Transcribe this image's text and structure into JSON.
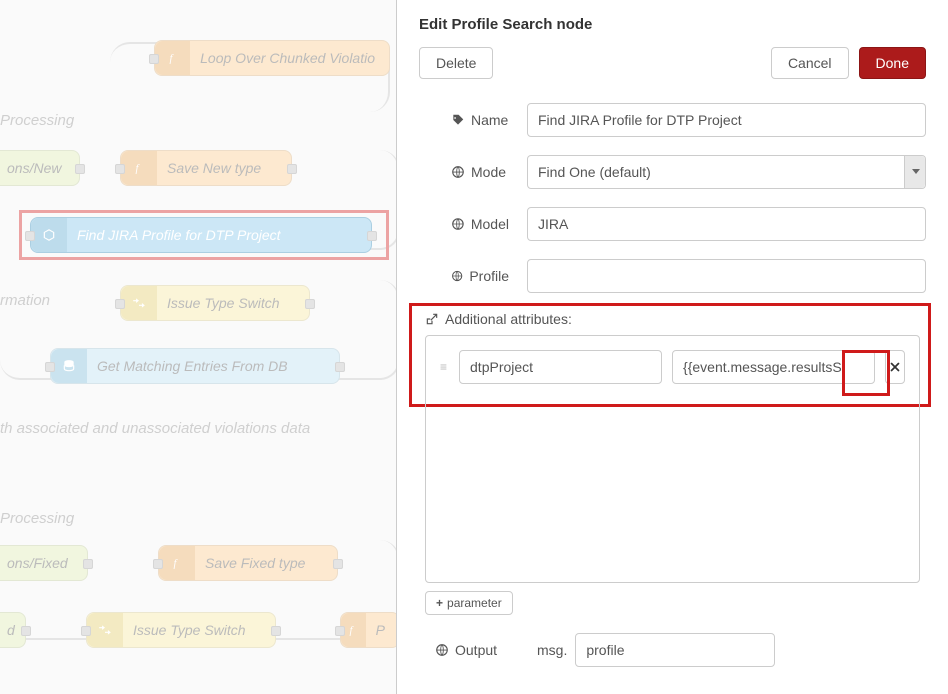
{
  "panel": {
    "title": "Edit Profile Search node",
    "delete": "Delete",
    "cancel": "Cancel",
    "done": "Done",
    "labels": {
      "name": "Name",
      "mode": "Mode",
      "model": "Model",
      "profile": "Profile",
      "additional": "Additional attributes:",
      "output": "Output"
    },
    "fields": {
      "name": "Find JIRA Profile for DTP Project",
      "mode": "Find One (default)",
      "model": "JIRA",
      "profile": "",
      "attr_key": "dtpProject",
      "attr_value": "{{event.message.resultsS",
      "output_prefix": "msg.",
      "output_value": "profile",
      "add_param": "parameter"
    }
  },
  "workspace": {
    "comments": {
      "processing1": "Processing",
      "rmation": "rmation",
      "withAssoc": "th associated and unassociated violations data",
      "processing2": "Processing"
    },
    "nodes": {
      "loop": "Loop Over Chunked Violatio",
      "onsNew": "ons/New",
      "saveNew": "Save New type",
      "findJira": "Find JIRA Profile for DTP Project",
      "switch1": "Issue Type Switch",
      "getMatch": "Get Matching Entries From DB",
      "onsFixed": "ons/Fixed",
      "saveFixed": "Save Fixed type",
      "d": "d",
      "switch2": "Issue Type Switch",
      "p": "P"
    }
  }
}
